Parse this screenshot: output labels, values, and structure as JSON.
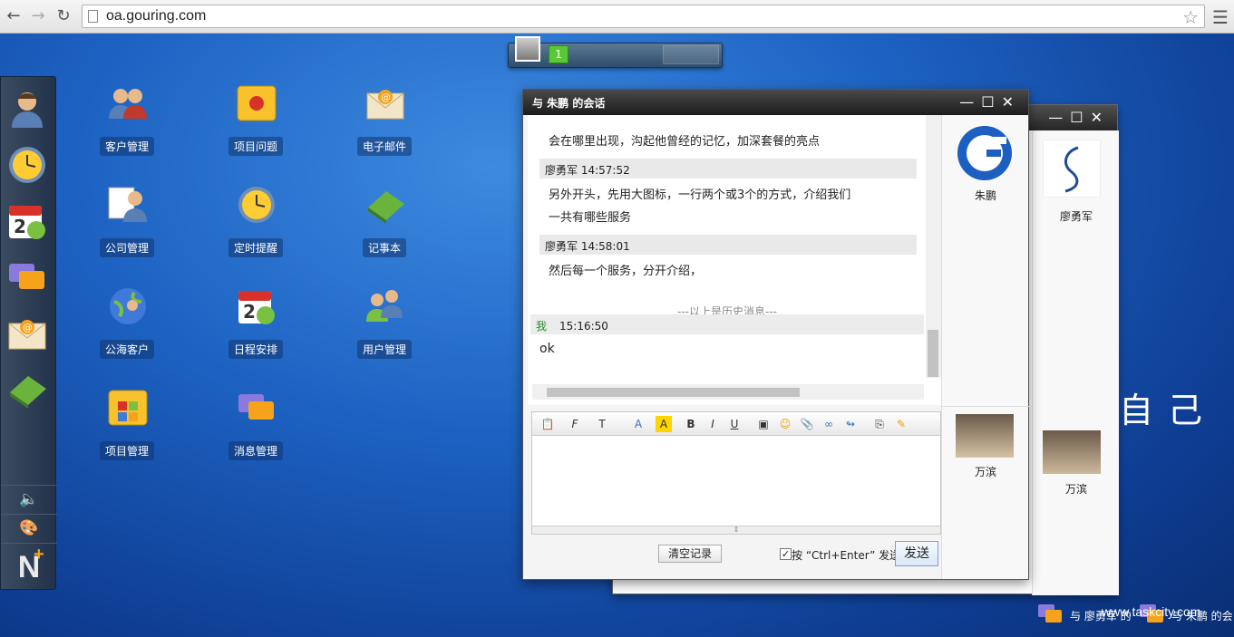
{
  "browser": {
    "url": "oa.gouring.com"
  },
  "dock": {
    "items": [
      "user-profile-icon",
      "clock-icon",
      "calendar-icon",
      "chat-icon",
      "mail-icon",
      "notebook-icon"
    ],
    "utilities": {
      "sound_icon": "🔈",
      "palette_icon": "🎨",
      "new_label": "N"
    }
  },
  "desktop": {
    "apps": [
      {
        "label": "客户管理"
      },
      {
        "label": "项目问题"
      },
      {
        "label": "电子邮件"
      },
      {
        "label": "公司管理"
      },
      {
        "label": "定时提醒"
      },
      {
        "label": "记事本"
      },
      {
        "label": "公海客户"
      },
      {
        "label": "日程安排"
      },
      {
        "label": "用户管理"
      },
      {
        "label": "项目管理"
      },
      {
        "label": "消息管理"
      }
    ],
    "big_text": "自己"
  },
  "taskbar_top": {
    "badge": "1"
  },
  "chat_back": {
    "contact1": "廖勇军",
    "contact2": "万滨"
  },
  "chat": {
    "title": "与 朱鹏 的会话",
    "messages": [
      {
        "text": "会在哪里出现，沟起他曾经的记忆，加深套餐的亮点"
      },
      {
        "header": "廖勇军 14:57:52",
        "text1": "另外开头，先用大图标，一行两个或3个的方式，介绍我们",
        "text2": "一共有哪些服务"
      },
      {
        "header": "廖勇军 14:58:01",
        "text": "然后每一个服务，分开介绍，"
      }
    ],
    "history_note": "---以上是历史消息---",
    "my_message": {
      "name": "我",
      "time": "15:16:50",
      "text": "ok"
    },
    "clear_label": "清空记录",
    "enter_label": "按 “Ctrl+Enter” 发送",
    "send_label": "发送",
    "side": {
      "contact1": "朱鹏",
      "contact2": "万滨"
    }
  },
  "taskbar_bottom": {
    "item1": "与 廖勇军 的",
    "item2": "与 朱鹏 的会"
  },
  "watermark": "www.taskcity.com",
  "colors": {
    "desktop": "#1d62c2",
    "titlebar": "#262626",
    "accent_green": "#59c837"
  }
}
